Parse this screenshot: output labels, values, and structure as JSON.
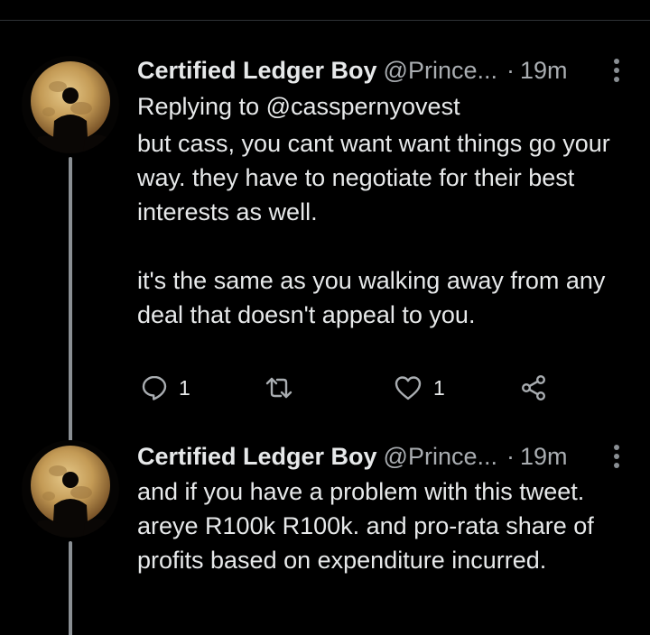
{
  "tweets": [
    {
      "author_name": "Certified Ledger Boy",
      "handle": "@Prince...",
      "separator": "·",
      "time": "19m",
      "replying_to": "Replying to @casspernyovest",
      "paragraphs": [
        "but cass, you cant want want things go your way. they have to negotiate for their best interests as well.",
        "it's the same as you walking away from any deal that doesn't appeal to you."
      ],
      "reply_count": "1",
      "like_count": "1"
    },
    {
      "author_name": "Certified Ledger Boy",
      "handle": "@Prince...",
      "separator": "·",
      "time": "19m",
      "paragraphs": [
        "and if you have a problem with this tweet. areye R100k R100k. and pro-rata share of profits based on expenditure incurred."
      ]
    }
  ],
  "icons": {
    "reply": "speech-bubble-icon",
    "retweet": "retweet-arrows-icon",
    "like": "heart-outline-icon",
    "share": "share-nodes-icon",
    "more": "vertical-dots-icon"
  },
  "colors": {
    "background": "#000000",
    "text": "#e7e9ea",
    "secondary_text": "#a9adb1",
    "thread_line": "#8a8f94"
  }
}
